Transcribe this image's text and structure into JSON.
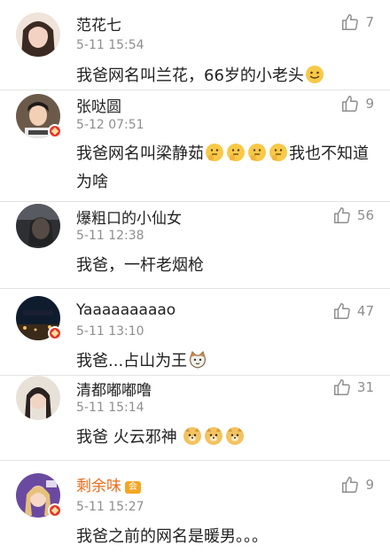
{
  "comments": [
    {
      "name": "范花七",
      "time": "5-11 15:54",
      "likes": "7",
      "text": "我爸网名叫兰花，66岁的小老头",
      "emoji": [
        "smile"
      ]
    },
    {
      "name": "张哒圆",
      "time": "5-12 07:51",
      "likes": "9",
      "text": "我爸网名叫梁静茹",
      "emoji": [
        "think",
        "think",
        "think",
        "think"
      ],
      "text_after": "我也不知道为啥"
    },
    {
      "name": "爆粗口的小仙女",
      "time": "5-11 12:38",
      "likes": "56",
      "text": "我爸，一杆老烟枪"
    },
    {
      "name": "Yaaaaaaaaao",
      "time": "5-11 13:10",
      "likes": "47",
      "text": "我爸...占山为王",
      "emoji": [
        "cat"
      ]
    },
    {
      "name": "清都嘟嘟噜",
      "time": "5-11 15:14",
      "likes": "31",
      "text": "我爸 火云邪神",
      "emoji": [
        "doge",
        "doge",
        "doge"
      ]
    },
    {
      "name": "剩余味",
      "time": "5-11 15:27",
      "likes": "9",
      "text": "我爸之前的网名是暖男。。。",
      "vip_badge": "会"
    }
  ],
  "icons": {
    "like": "thumbs-up-icon",
    "verified": "verified-badge-icon"
  },
  "colors": {
    "vip_name": "#ea6b1b",
    "badge": "#e8352b",
    "meta": "#8e8e8e",
    "text": "#222222"
  }
}
